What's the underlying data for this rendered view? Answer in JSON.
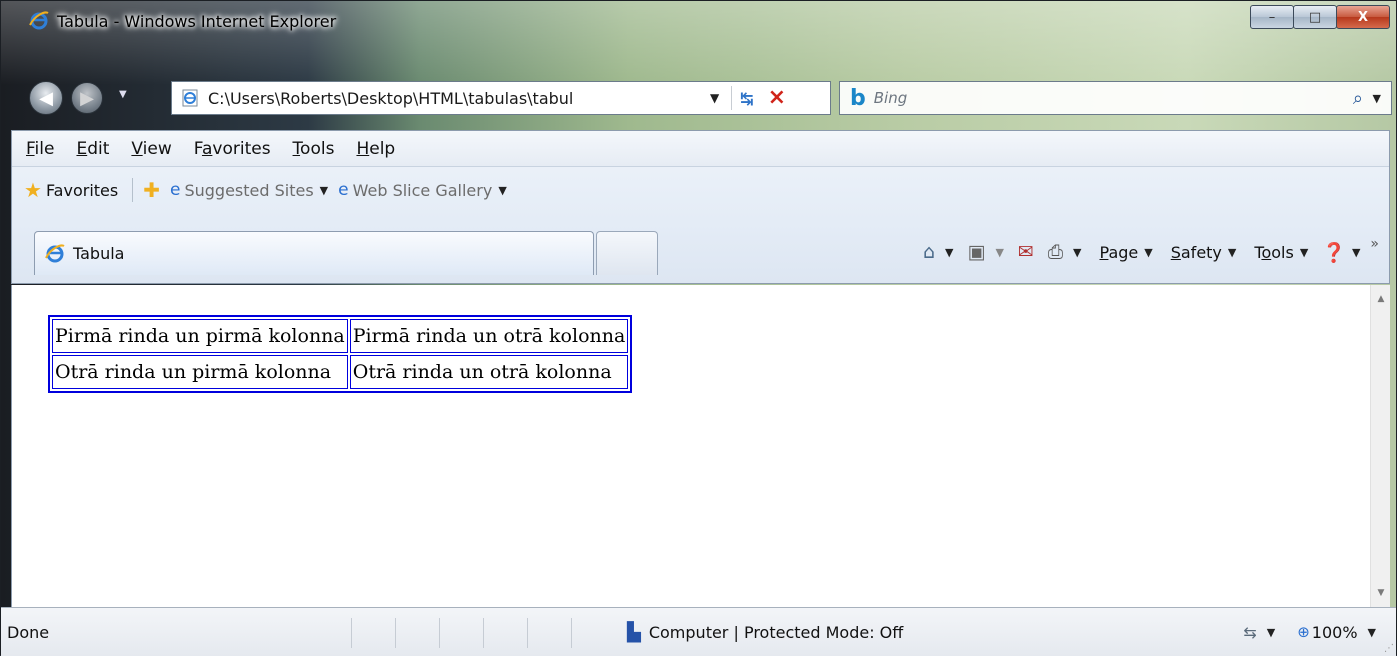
{
  "window": {
    "title": "Tabula - Windows Internet Explorer",
    "controls": {
      "minimize": "–",
      "maximize": "□",
      "close": "X"
    }
  },
  "address_bar": {
    "url": "C:\\Users\\Roberts\\Desktop\\HTML\\tabulas\\tabul",
    "search_placeholder": "Bing"
  },
  "menu": {
    "items": [
      {
        "label": "File",
        "accel": "F",
        "rest": "ile"
      },
      {
        "label": "Edit",
        "accel": "E",
        "rest": "dit"
      },
      {
        "label": "View",
        "accel": "V",
        "rest": "iew"
      },
      {
        "label": "Favorites",
        "pre": "F",
        "accel": "a",
        "rest": "vorites"
      },
      {
        "label": "Tools",
        "accel": "T",
        "rest": "ools"
      },
      {
        "label": "Help",
        "accel": "H",
        "rest": "elp"
      }
    ]
  },
  "favorites_bar": {
    "favorites_label": "Favorites",
    "suggested_sites": "Suggested Sites",
    "web_slice_gallery": "Web Slice Gallery"
  },
  "tabs": {
    "active_label": "Tabula"
  },
  "command_bar": {
    "page": {
      "accel": "P",
      "rest": "age"
    },
    "safety": {
      "accel": "S",
      "rest": "afety"
    },
    "tools": {
      "pre": "T",
      "accel": "o",
      "rest": "ols"
    }
  },
  "page": {
    "table": [
      [
        "Pirmā rinda un pirmā kolonna",
        "Pirmā rinda un otrā kolonna"
      ],
      [
        "Otrā rinda un pirmā kolonna",
        "Otrā rinda un otrā kolonna"
      ]
    ],
    "border_color": "#0000dd"
  },
  "status_bar": {
    "status": "Done",
    "zone": "Computer | Protected Mode: Off",
    "zoom": "100%"
  }
}
